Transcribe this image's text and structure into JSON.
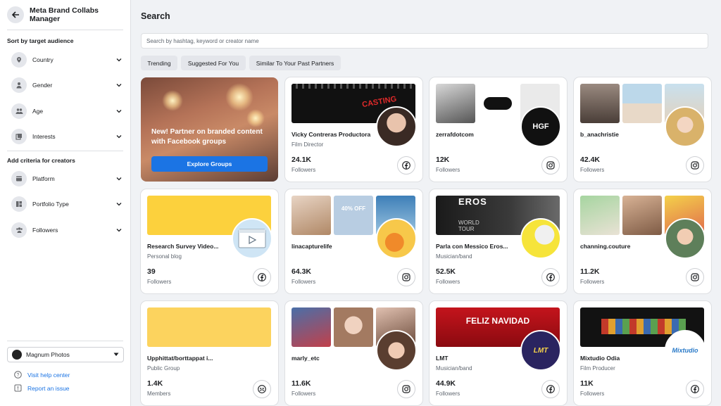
{
  "app": {
    "title": "Meta Brand Collabs Manager"
  },
  "sidebar": {
    "section1": "Sort by target audience",
    "audience_filters": [
      {
        "label": "Country",
        "icon": "location-icon"
      },
      {
        "label": "Gender",
        "icon": "person-icon"
      },
      {
        "label": "Age",
        "icon": "people-icon"
      },
      {
        "label": "Interests",
        "icon": "interests-icon"
      }
    ],
    "section2": "Add criteria for creators",
    "creator_filters": [
      {
        "label": "Platform",
        "icon": "platform-icon"
      },
      {
        "label": "Portfolio Type",
        "icon": "portfolio-icon"
      },
      {
        "label": "Followers",
        "icon": "followers-icon"
      }
    ],
    "account": "Magnum Photos",
    "links": [
      {
        "label": "Visit help center",
        "icon": "help-icon"
      },
      {
        "label": "Report an issue",
        "icon": "report-icon"
      }
    ]
  },
  "main": {
    "title": "Search",
    "search_placeholder": "Search by hashtag, keyword or creator name",
    "chips": [
      "Trending",
      "Suggested For You",
      "Similar To Your Past Partners"
    ],
    "promo": {
      "text": "New! Partner on branded content with Facebook groups",
      "button": "Explore Groups"
    },
    "cards": [
      {
        "name": "Vicky Contreras Productora",
        "category": "Film Director",
        "count": "24.1K",
        "count_label": "Followers",
        "platform": "facebook"
      },
      {
        "name": "zerrafdotcom",
        "category": "",
        "count": "12K",
        "count_label": "Followers",
        "platform": "instagram"
      },
      {
        "name": "b_anachristie",
        "category": "",
        "count": "42.4K",
        "count_label": "Followers",
        "platform": "instagram"
      },
      {
        "name": "Research Survey Video...",
        "category": "Personal blog",
        "count": "39",
        "count_label": "Followers",
        "platform": "facebook"
      },
      {
        "name": "linacapturelife",
        "category": "",
        "count": "64.3K",
        "count_label": "Followers",
        "platform": "instagram"
      },
      {
        "name": "Parla con Messico Eros...",
        "category": "Musician/band",
        "count": "52.5K",
        "count_label": "Followers",
        "platform": "facebook"
      },
      {
        "name": "channing.couture",
        "category": "",
        "count": "11.2K",
        "count_label": "Followers",
        "platform": "instagram"
      },
      {
        "name": "Upphittat/borttappat i...",
        "category": "Public Group",
        "count": "1.4K",
        "count_label": "Members",
        "platform": "group"
      },
      {
        "name": "marly_etc",
        "category": "",
        "count": "11.6K",
        "count_label": "Followers",
        "platform": "instagram"
      },
      {
        "name": "LMT",
        "category": "Musician/band",
        "count": "44.9K",
        "count_label": "Followers",
        "platform": "facebook"
      },
      {
        "name": "Mixtudio Odia",
        "category": "Film Producer",
        "count": "11K",
        "count_label": "Followers",
        "platform": "facebook"
      }
    ],
    "thumb_text": {
      "casting": "CASTING",
      "hgf": "HGF",
      "sale": "40% OFF",
      "eros": "EROS",
      "eros_sub": "WORLD TOUR",
      "feliz": "FELIZ NAVIDAD",
      "lmt": "LMT",
      "mixtudio": "Mixtudio"
    }
  }
}
